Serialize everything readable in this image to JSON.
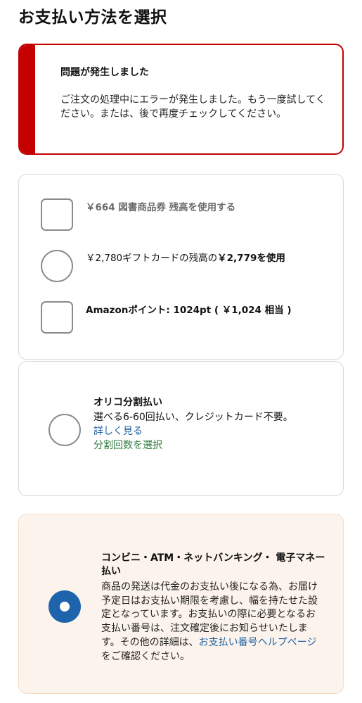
{
  "page": {
    "title": "お支払い方法を選択"
  },
  "alert": {
    "heading": "問題が発生しました",
    "message": "ご注文の処理中にエラーが発生しました。もう一度試してください。または、後で再度チェックしてください。",
    "color": "#c40000"
  },
  "balances": {
    "options": [
      {
        "type": "checkbox",
        "label": "￥664 図書商品券 残高を使用する",
        "checked": false,
        "disabled": true
      },
      {
        "type": "radio",
        "label_prefix": "￥2,780ギフトカードの残高の",
        "label_bold": "￥2,779を使用",
        "checked": false
      },
      {
        "type": "checkbox",
        "label": "Amazonポイント: 1024pt ( ￥1,024 相当 )",
        "checked": false
      }
    ]
  },
  "orico": {
    "title": "オリコ分割払い",
    "description": "選べる6-60回払い、クレジットカード不要。",
    "details_link": "詳しく見る",
    "installment_link": "分割回数を選択",
    "selected": false
  },
  "conbini": {
    "title": "コンビニ・ATM・ネットバンキング・ 電子マネー払い",
    "description_before": "商品の発送は代金のお支払い後になる為、お届け予定日はお支払い期限を考慮し、幅を持たせた設定となっています。お支払いの際に必要となるお支払い番号は、注文確定後にお知らせいたします。その他の詳細は、",
    "help_link": "お支払い番号ヘルプページ",
    "description_after": "をご確認ください。",
    "selected": true,
    "accent": "#1d64ad"
  }
}
